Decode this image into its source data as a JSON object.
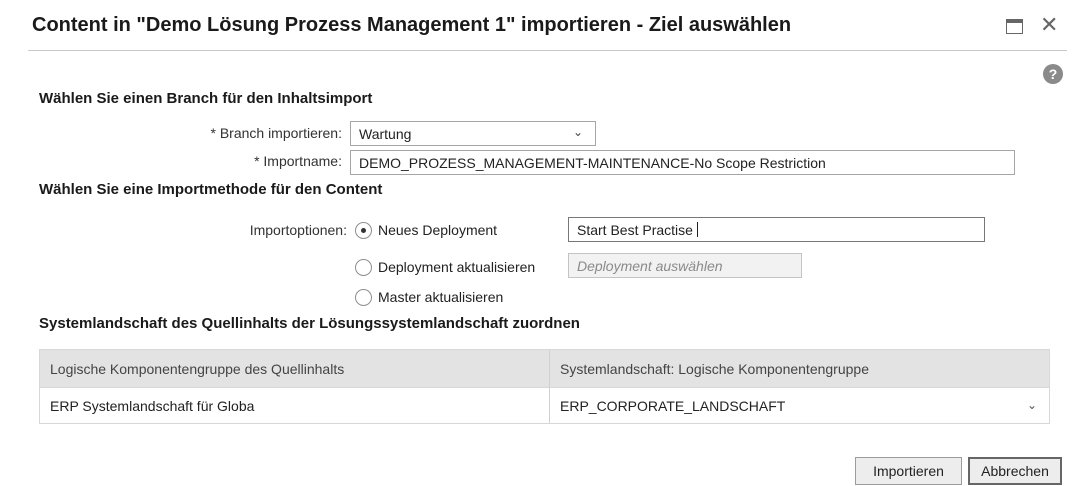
{
  "dialog": {
    "title": "Content in \"Demo Lösung Prozess Management 1\" importieren - Ziel auswählen",
    "help_glyph": "?"
  },
  "branch_section": {
    "heading": "Wählen Sie einen Branch für den Inhaltsimport",
    "branch_label": "* Branch importieren:",
    "branch_value": "Wartung",
    "importname_label": "* Importname:",
    "importname_value": "DEMO_PROZESS_MANAGEMENT-MAINTENANCE-No Scope Restriction"
  },
  "method_section": {
    "heading": "Wählen Sie eine Importmethode für den Content",
    "options_label": "Importoptionen:",
    "options": [
      {
        "label": "Neues Deployment",
        "checked": true
      },
      {
        "label": "Deployment aktualisieren",
        "checked": false
      },
      {
        "label": "Master aktualisieren",
        "checked": false
      }
    ],
    "new_deployment_value": "Start Best Practise",
    "update_deployment_placeholder": "Deployment auswählen"
  },
  "mapping_section": {
    "heading": "Systemlandschaft des Quellinhalts der Lösungssystemlandschaft zuordnen",
    "columns": [
      "Logische Komponentengruppe des Quellinhalts",
      "Systemlandschaft: Logische Komponentengruppe"
    ],
    "rows": [
      [
        "ERP Systemlandschaft für Globa",
        "ERP_CORPORATE_LANDSCHAFT"
      ]
    ]
  },
  "footer": {
    "import_label": "Importieren",
    "cancel_label": "Abbrechen"
  },
  "icons": {
    "maximize": "maximize-icon",
    "close": "close-icon",
    "help": "help-icon",
    "dropdown": "chevron-down-icon"
  }
}
